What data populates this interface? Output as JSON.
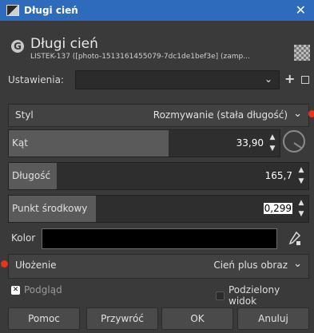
{
  "window": {
    "title": "Długi cień",
    "close_glyph": "✕"
  },
  "header": {
    "operation_name": "Długi cień",
    "subtitle": "LISTEK-137 ([photo-1513161455079-7dc1de1bef3e] (zamp...",
    "logo_glyph": "G"
  },
  "presets": {
    "label": "Ustawienia:",
    "value": "",
    "add_glyph": "+",
    "chev": "⌄"
  },
  "style": {
    "label": "Styl",
    "value": "Rozmywanie (stała długość)",
    "chev": "⌄"
  },
  "angle": {
    "label": "Kąt",
    "value": "33,90",
    "fill_fraction": 0.59
  },
  "length": {
    "label": "Długość",
    "value": "165,7",
    "fill_fraction": 0.16
  },
  "midpoint": {
    "label": "Punkt środkowy",
    "value": "0,299",
    "fill_fraction": 0.29
  },
  "color": {
    "label": "Kolor",
    "swatch_hex": "#000000"
  },
  "composition": {
    "label": "Ułożenie",
    "value": "Cień plus obraz",
    "chev": "⌄"
  },
  "preview": {
    "label": "Podgląd",
    "checked": true,
    "check_glyph": "✕"
  },
  "split_view": {
    "label": "Podzielony widok",
    "checked": false
  },
  "buttons": {
    "help": "Pomoc",
    "reset": "Przywróć",
    "ok": "OK",
    "cancel": "Anuluj"
  },
  "colors": {
    "titlebar": "#2f6bbd",
    "background": "#3a3a3a",
    "marker": "#e8341e"
  }
}
